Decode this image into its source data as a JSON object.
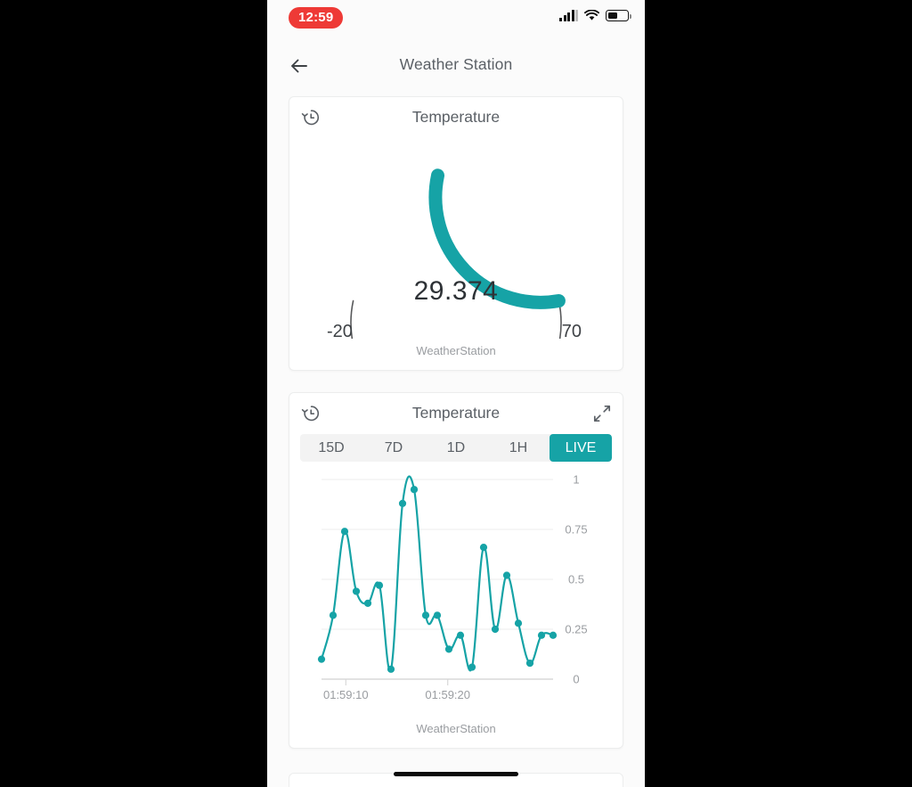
{
  "status_bar": {
    "time": "12:59",
    "signal_icon": "signal-bars-icon",
    "wifi_icon": "wifi-icon",
    "battery_icon": "battery-icon",
    "battery_level_pct": 44
  },
  "nav": {
    "back_icon": "back-arrow-icon",
    "title": "Weather Station"
  },
  "theme": {
    "accent": "#16a3a6",
    "text": "#5b6066",
    "muted": "#9a9da1",
    "page_bg": "#fbfbfb",
    "card_bg": "#ffffff",
    "time_pill_bg": "#ee3a36",
    "track": "#58595b",
    "tabs_bg": "#f3f3f3"
  },
  "gauge_card": {
    "history_icon": "history-icon",
    "title": "Temperature",
    "footer": "WeatherStation",
    "value": "29.374",
    "min_label": "-20",
    "max_label": "70"
  },
  "chart_card": {
    "history_icon": "history-icon",
    "title": "Temperature",
    "expand_icon": "expand-icon",
    "footer": "WeatherStation",
    "tabs": [
      {
        "label": "15D",
        "active": false
      },
      {
        "label": "7D",
        "active": false
      },
      {
        "label": "1D",
        "active": false
      },
      {
        "label": "1H",
        "active": false
      },
      {
        "label": "LIVE",
        "active": true
      }
    ]
  },
  "chart_data": [
    {
      "type": "gauge",
      "title": "Temperature",
      "value": 29.374,
      "value_label": "29.374",
      "min": -20,
      "max": 70,
      "min_label": "-20",
      "max_label": "70",
      "fill_fraction": 0.549,
      "arc_color": "#16a3a6",
      "track_color": "#58595b",
      "footer": "WeatherStation"
    },
    {
      "type": "line",
      "title": "Temperature",
      "xlabel": "",
      "ylabel": "",
      "ylim": [
        0,
        1
      ],
      "yticks": [
        0,
        0.25,
        0.5,
        0.75,
        1
      ],
      "ytick_labels": [
        "0",
        "0.25",
        "0.5",
        "0.75",
        "1"
      ],
      "grid": true,
      "legend": "none",
      "series_color": "#16a3a6",
      "xtick_labels": [
        "01:59:10",
        "01:59:20"
      ],
      "xtick_positions": [
        0.105,
        0.545
      ],
      "x": [
        0,
        1,
        2,
        3,
        4,
        5,
        6,
        7,
        8,
        9,
        10,
        11,
        12,
        13,
        14,
        15,
        16,
        17,
        18,
        19,
        20
      ],
      "values": [
        0.1,
        0.32,
        0.74,
        0.44,
        0.38,
        0.47,
        0.05,
        0.88,
        0.95,
        0.32,
        0.32,
        0.15,
        0.22,
        0.06,
        0.66,
        0.25,
        0.52,
        0.28,
        0.08,
        0.22,
        0.22
      ],
      "footer": "WeatherStation"
    }
  ]
}
